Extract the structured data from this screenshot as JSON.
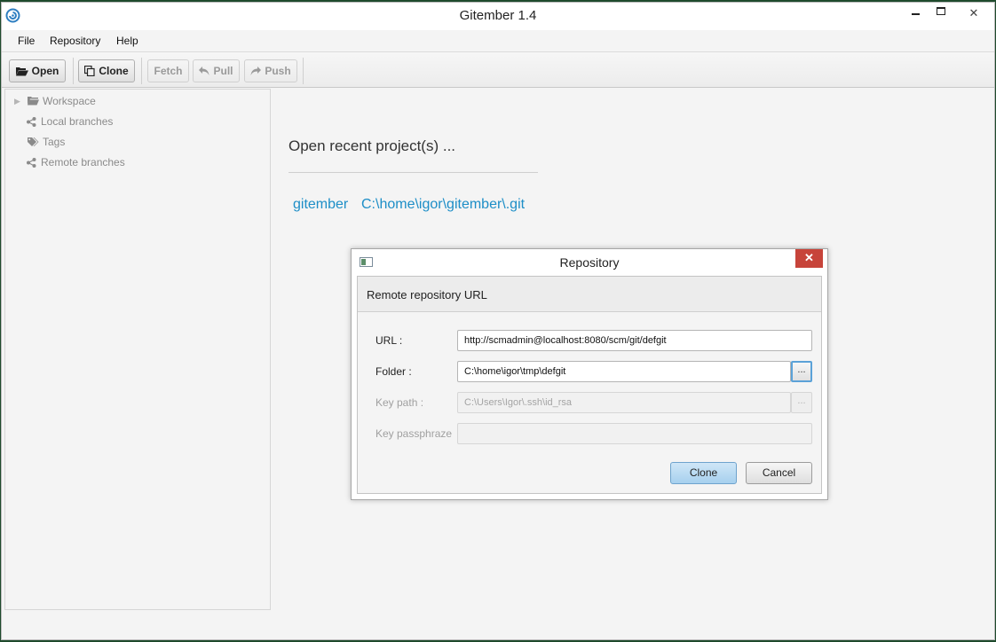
{
  "window": {
    "title": "Gitember 1.4",
    "controls": {
      "minimize_icon": "minimize-icon",
      "maximize_icon": "maximize-icon",
      "close_glyph": "✕"
    }
  },
  "menu": [
    "File",
    "Repository",
    "Help"
  ],
  "toolbar": {
    "open_label": "Open",
    "clone_label": "Clone",
    "fetch_label": "Fetch",
    "pull_label": "Pull",
    "push_label": "Push"
  },
  "sidebar": {
    "items": [
      {
        "label": "Workspace",
        "icon": "folder-icon"
      },
      {
        "label": "Local branches",
        "icon": "branch-icon"
      },
      {
        "label": "Tags",
        "icon": "tags-icon"
      },
      {
        "label": "Remote branches",
        "icon": "branch-icon"
      }
    ]
  },
  "recent": {
    "title": "Open recent project(s) ...",
    "project_name": "gitember",
    "project_path": "C:\\home\\igor\\gitember\\.git"
  },
  "dialog": {
    "title": "Repository",
    "close_glyph": "✕",
    "header": "Remote repository URL",
    "fields": {
      "url_label": "URL :",
      "url_value": "http://scmadmin@localhost:8080/scm/git/defgit",
      "folder_label": "Folder :",
      "folder_value": "C:\\home\\igor\\tmp\\defgit",
      "keypath_label": "Key path :",
      "keypath_value": "C:\\Users\\Igor\\.ssh\\id_rsa",
      "passphrase_label": "Key passphraze",
      "passphrase_value": "",
      "browse_label": "..."
    },
    "buttons": {
      "clone": "Clone",
      "cancel": "Cancel"
    }
  },
  "colors": {
    "link": "#1d8ec7",
    "close_red": "#c7443a",
    "default_button": "#a6d0ee"
  }
}
